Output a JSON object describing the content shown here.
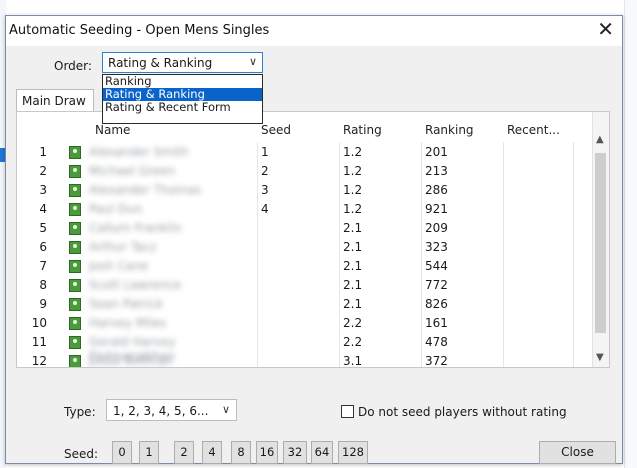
{
  "window": {
    "title": "Automatic Seeding - Open Mens Singles",
    "close_glyph": "✕"
  },
  "order": {
    "label": "Order:",
    "selected": "Rating & Ranking",
    "options": [
      "Ranking",
      "Rating & Ranking",
      "Rating & Recent Form"
    ],
    "highlighted_index": 1
  },
  "tab": {
    "label": "Main Draw"
  },
  "table": {
    "columns": [
      "Name",
      "Seed",
      "Rating",
      "Ranking",
      "Recent..."
    ],
    "rows": [
      {
        "num": "1",
        "name": "Alexander Smith",
        "seed": "1",
        "rating": "1.2",
        "ranking": "201"
      },
      {
        "num": "2",
        "name": "Michael Green",
        "seed": "2",
        "rating": "1.2",
        "ranking": "213"
      },
      {
        "num": "3",
        "name": "Alexander Thomas",
        "seed": "3",
        "rating": "1.2",
        "ranking": "286"
      },
      {
        "num": "4",
        "name": "Paul Dun",
        "seed": "4",
        "rating": "1.2",
        "ranking": "921"
      },
      {
        "num": "5",
        "name": "Callum Franklin",
        "seed": "",
        "rating": "2.1",
        "ranking": "209"
      },
      {
        "num": "6",
        "name": "Arthur Tacz",
        "seed": "",
        "rating": "2.1",
        "ranking": "323"
      },
      {
        "num": "7",
        "name": "Josh Cane",
        "seed": "",
        "rating": "2.1",
        "ranking": "544"
      },
      {
        "num": "8",
        "name": "Scott Lawrence",
        "seed": "",
        "rating": "2.1",
        "ranking": "772"
      },
      {
        "num": "9",
        "name": "Sean Patrick",
        "seed": "",
        "rating": "2.1",
        "ranking": "826"
      },
      {
        "num": "10",
        "name": "Harvey Miles",
        "seed": "",
        "rating": "2.2",
        "ranking": "161"
      },
      {
        "num": "11",
        "name": "Gerald Harvey Padmanabhan",
        "seed": "",
        "rating": "2.2",
        "ranking": "478"
      },
      {
        "num": "12",
        "name": "Josue Bethran",
        "seed": "",
        "rating": "3.1",
        "ranking": "372"
      }
    ]
  },
  "type": {
    "label": "Type:",
    "selected": "1, 2, 3, 4, 5, 6..."
  },
  "option_checkbox": {
    "label": "Do not seed players without rating",
    "checked": false
  },
  "seed": {
    "label": "Seed:",
    "buttons": [
      "0",
      "1",
      "2",
      "4",
      "8",
      "16",
      "32",
      "64",
      "128"
    ]
  },
  "close_button": {
    "label": "Close"
  }
}
